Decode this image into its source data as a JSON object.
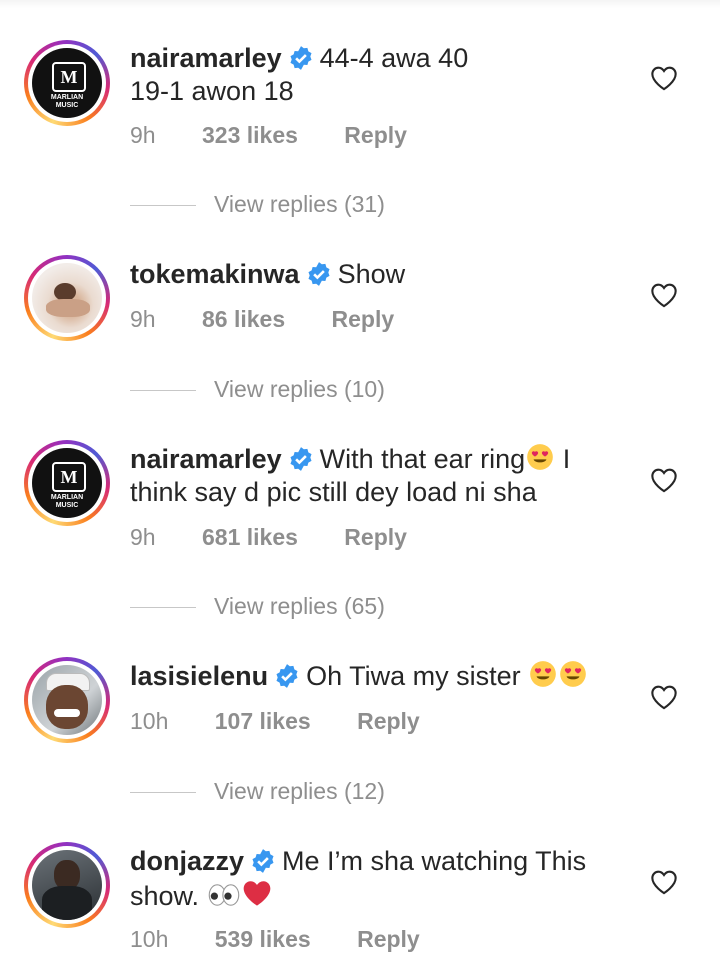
{
  "comments": [
    {
      "username": "nairamarley",
      "text": "44-4 awa 40\n19-1 awon 18",
      "line1": "44-4 awa 40",
      "line2": "19-1 awon 18",
      "time": "9h",
      "likes": "323 likes",
      "reply": "Reply",
      "view_replies": "View replies (31)",
      "avatar_logo": "MARLIAN MUSIC"
    },
    {
      "username": "tokemakinwa",
      "line1": "Show",
      "time": "9h",
      "likes": "86 likes",
      "reply": "Reply",
      "view_replies": "View replies (10)"
    },
    {
      "username": "nairamarley",
      "line1": "With that ear ring",
      "line1_tail": "I",
      "line2": "think say d pic still dey load ni sha",
      "time": "9h",
      "likes": "681 likes",
      "reply": "Reply",
      "view_replies": "View replies (65)",
      "avatar_logo": "MARLIAN MUSIC"
    },
    {
      "username": "lasisielenu",
      "line1": "Oh Tiwa my sister",
      "time": "10h",
      "likes": "107 likes",
      "reply": "Reply",
      "view_replies": "View replies (12)"
    },
    {
      "username": "donjazzy",
      "line1": "Me I’m sha watching This",
      "line2": "show.",
      "time": "10h",
      "likes": "539 likes",
      "reply": "Reply"
    }
  ],
  "icons": {
    "verified": "verified-badge-icon",
    "heart": "heart-outline-icon",
    "emoji_heart_eyes": "heart-eyes-emoji",
    "emoji_eyes": "eyes-emoji",
    "emoji_red_heart": "red-heart-emoji"
  },
  "colors": {
    "verified_blue": "#3897f0",
    "meta_gray": "#8e8e8e",
    "text": "#262626"
  }
}
